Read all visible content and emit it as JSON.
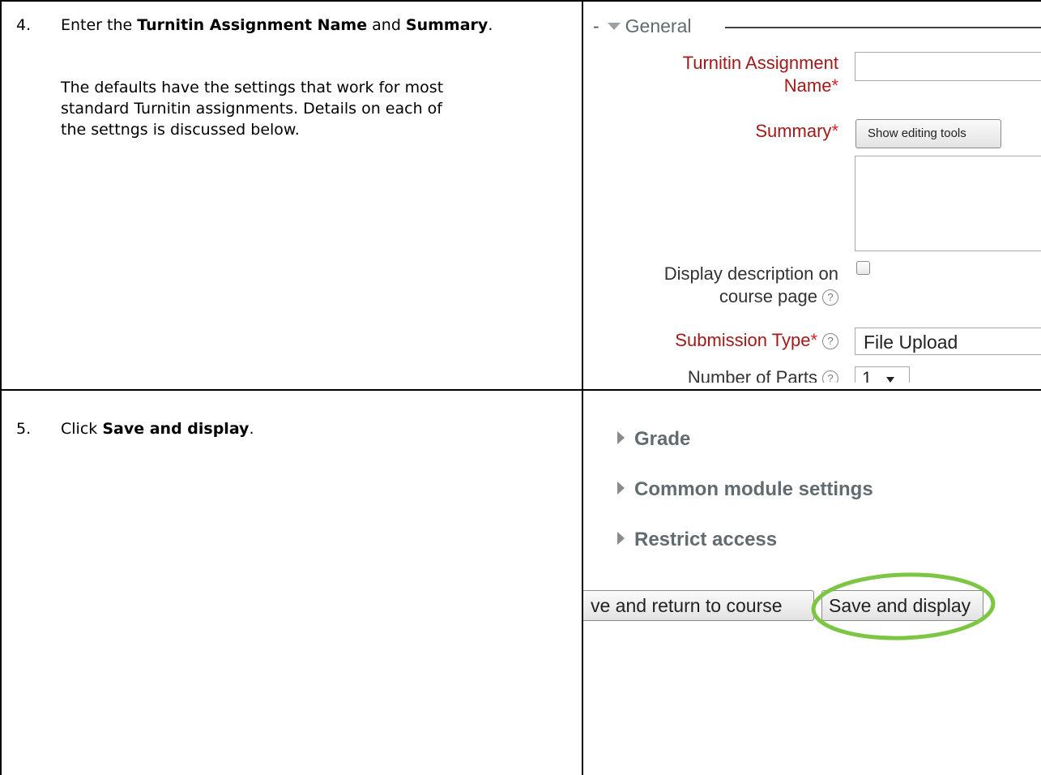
{
  "step4": {
    "number": "4.",
    "text_before": "Enter the ",
    "bold1": "Turnitin Assignment Name",
    "text_mid": " and ",
    "bold2": "Summary",
    "text_end": ".",
    "paragraph_line1": "The defaults have the settings that work for most",
    "paragraph_line2": "standard Turnitin assignments. Details on each of",
    "paragraph_line3": "the settngs is discussed below."
  },
  "step5": {
    "number": "5.",
    "text_before": "Click ",
    "bold": "Save and display",
    "text_end": "."
  },
  "form": {
    "collapse_dash": "-",
    "legend": "General",
    "name_label_line1": "Turnitin Assignment",
    "name_label_line2": "Name",
    "required_mark": "*",
    "summary_label": "Summary",
    "show_editing_tools": "Show editing tools",
    "display_desc_line1": "Display description on",
    "display_desc_line2": "course page",
    "submission_type_label": "Submission Type",
    "submission_type_value": "File Upload",
    "parts_label": "Number of Parts",
    "parts_value": "1",
    "help_glyph": "?"
  },
  "sections": {
    "grade": "Grade",
    "common": "Common module settings",
    "restrict": "Restrict access"
  },
  "buttons": {
    "save_return": "ve and return to course",
    "save_display": "Save and display"
  },
  "colors": {
    "required_label": "#a11a1a",
    "section_heading": "#616b70",
    "highlight_ellipse": "#7cc644"
  }
}
